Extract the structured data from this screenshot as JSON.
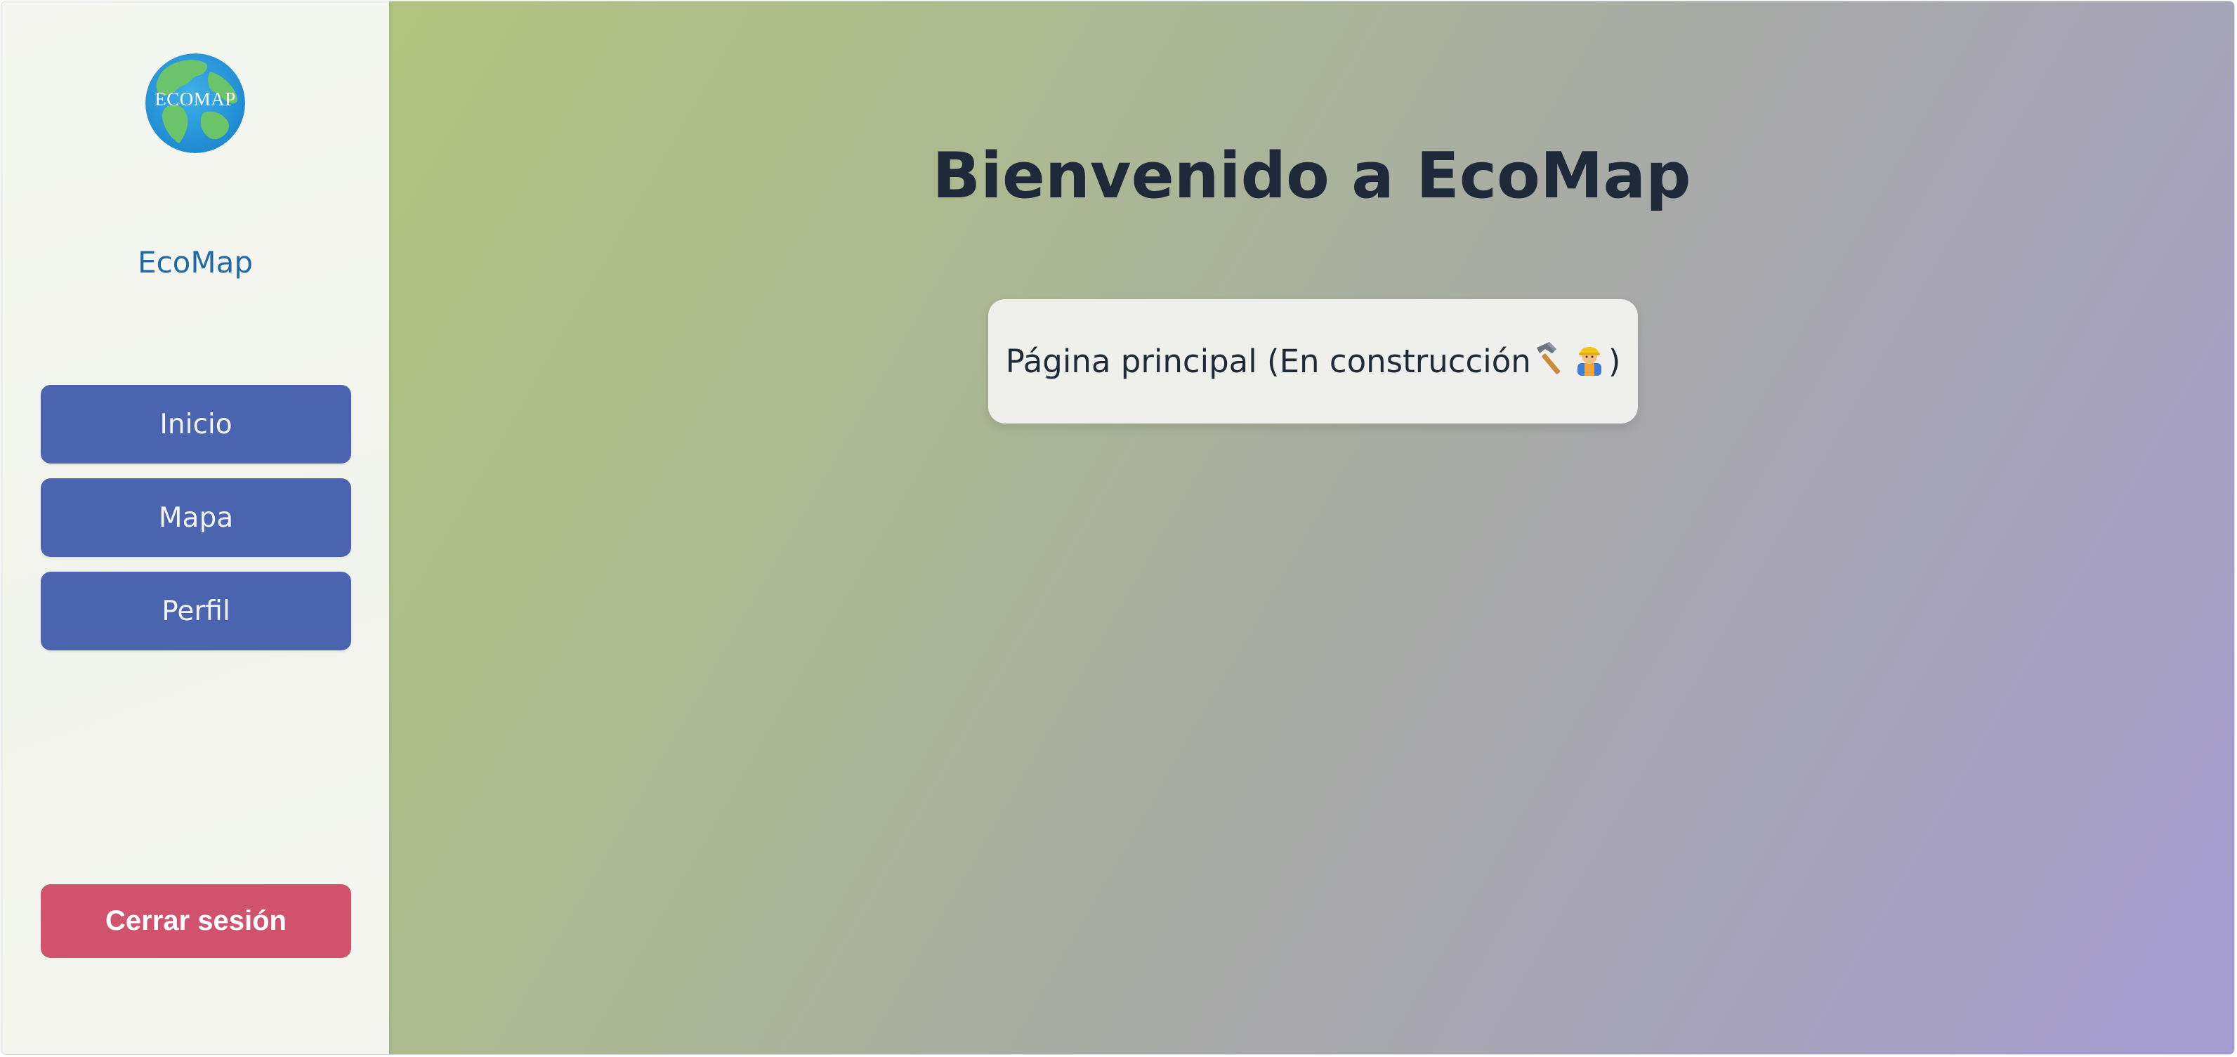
{
  "sidebar": {
    "logo_text": "ECOMAP",
    "brand": "EcoMap",
    "nav": [
      {
        "label": "Inicio"
      },
      {
        "label": "Mapa"
      },
      {
        "label": "Perfil"
      }
    ],
    "logout_label": "Cerrar sesión"
  },
  "main": {
    "title": "Bienvenido a EcoMap",
    "notice": {
      "prefix": "Página principal (En construcción",
      "hammer_icon": "hammer-icon",
      "worker_icon": "construction-worker-icon",
      "suffix": ")"
    }
  },
  "colors": {
    "brand_text": "#1f6aa8",
    "nav_button": "#4a64b0",
    "logout_button": "#d0526c",
    "title_text": "#1e2a3a"
  }
}
